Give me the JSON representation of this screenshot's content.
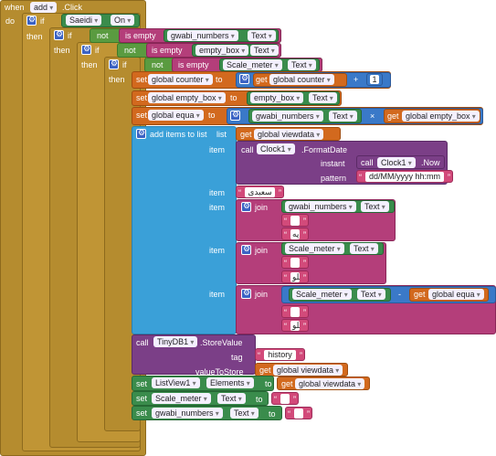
{
  "event": {
    "when": "when",
    "component": "add",
    "event": ".Click",
    "do": "do"
  },
  "kw": {
    "if": "if",
    "then": "then",
    "not": "not",
    "is_empty": "is empty",
    "set": "set",
    "to": "to",
    "get": "get",
    "call": "call",
    "item": "item",
    "join": "join",
    "instant": "instant",
    "pattern": "pattern",
    "tag": "tag",
    "value_to_store": "valueToStore",
    "add_items": "add items to list",
    "list": "list"
  },
  "conditions": {
    "c1_component": "Saeidi",
    "c1_prop": "On",
    "c2_component": "gwabi_numbers",
    "c2_prop": "Text",
    "c3_component": "empty_box",
    "c3_prop": "Text",
    "c4_component": "Scale_meter",
    "c4_prop": "Text"
  },
  "sets": {
    "counter": "global counter",
    "counter_get": "global counter",
    "plus": "+",
    "one": "1",
    "empty_box_var": "global empty_box",
    "empty_box_comp": "empty_box",
    "empty_box_prop": "Text",
    "equa": "global equa",
    "equa_comp": "gwabi_numbers",
    "equa_prop": "Text",
    "times": "×",
    "equa_get": "global empty_box"
  },
  "list": {
    "viewdata": "global viewdata",
    "clock": "Clock1",
    "format": ".FormatDate",
    "clock2": "Clock1",
    "now": ".Now",
    "pattern_val": "dd/MM/yyyy hh:mm",
    "item2": "سعیدی",
    "j1_comp": "gwabi_numbers",
    "j1_prop": "Text",
    "j1_s1": "-",
    "j1_s2": "قاپه",
    "j2_comp": "Scale_meter",
    "j2_prop": "Text",
    "j2_s1": "-",
    "j2_s2": "کیلو",
    "j3_comp": "Scale_meter",
    "j3_prop": "Text",
    "minus": "-",
    "j3_get": "global equa",
    "j3_s1": "-",
    "j3_s2": "کیلو"
  },
  "store": {
    "db": "TinyDB1",
    "method": ".StoreValue",
    "tag": "history",
    "value": "global viewdata"
  },
  "final": {
    "lv": "ListView1",
    "lv_prop": "Elements",
    "lv_get": "global viewdata",
    "sm": "Scale_meter",
    "sm_prop": "Text",
    "sm_val": "",
    "gn": "gwabi_numbers",
    "gn_prop": "Text",
    "gn_val": ""
  }
}
